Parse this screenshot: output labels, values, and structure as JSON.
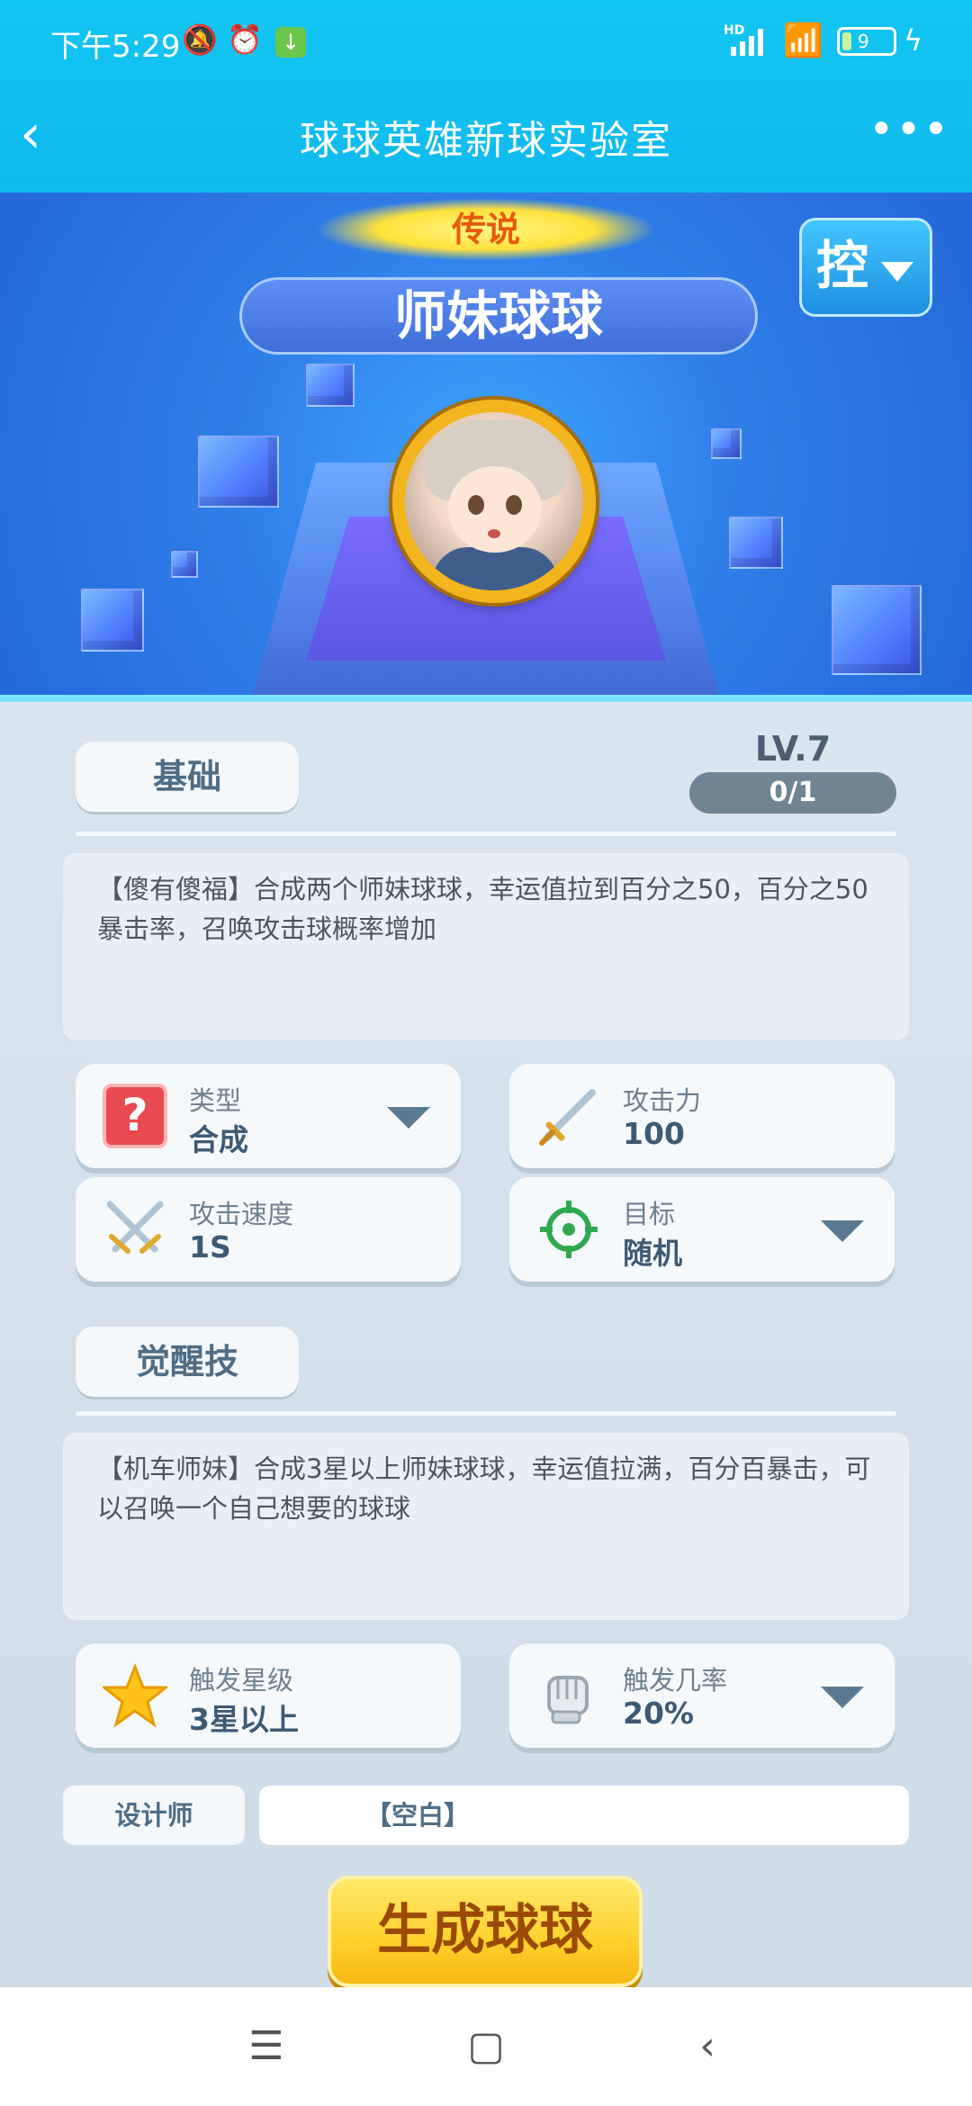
{
  "status_bar": {
    "time": "下午5:29",
    "network_label": "HD",
    "battery_level": "9",
    "icons": [
      "mute-bell-icon",
      "alarm-icon",
      "download-icon",
      "signal-icon",
      "wifi-icon",
      "battery-icon",
      "charging-icon"
    ]
  },
  "header": {
    "title": "球球英雄新球实验室",
    "back_icon": "chevron-left-icon",
    "more_icon": "more-dots-icon"
  },
  "hero": {
    "rarity": "传说",
    "ball_name": "师妹球球",
    "control_label": "控"
  },
  "basic": {
    "tab_label": "基础",
    "level": "LV.7",
    "progress": "0/1",
    "description": "【傻有傻福】合成两个师妹球球，幸运值拉到百分之50，百分之50暴击率，召唤攻击球概率增加",
    "stats": [
      {
        "label": "类型",
        "value": "合成",
        "icon": "question-icon"
      },
      {
        "label": "攻击力",
        "value": "100",
        "icon": "sword-icon"
      },
      {
        "label": "攻击速度",
        "value": "1S",
        "icon": "crossed-swords-icon"
      },
      {
        "label": "目标",
        "value": "随机",
        "icon": "target-icon"
      }
    ]
  },
  "awaken": {
    "tab_label": "觉醒技",
    "description": "【机车师妹】合成3星以上师妹球球，幸运值拉满，百分百暴击，可以召唤一个自己想要的球球",
    "stats": [
      {
        "label": "触发星级",
        "value": "3星以上",
        "icon": "star-icon"
      },
      {
        "label": "触发几率",
        "value": "20%",
        "icon": "gauntlet-icon"
      }
    ]
  },
  "designer": {
    "label": "设计师",
    "value": "【空白】"
  },
  "generate_button": "生成球球",
  "colors": {
    "header_bg": "#12c6f2",
    "accent_yellow": "#ffd02c",
    "panel_bg": "#d8e4ee"
  }
}
